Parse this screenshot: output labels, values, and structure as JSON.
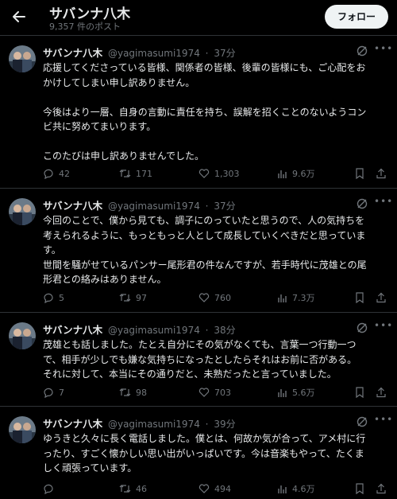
{
  "header": {
    "title": "サバンナ八木",
    "post_count": "9,357 件のポスト",
    "follow_label": "フォロー"
  },
  "colors": {
    "background": "#000000",
    "text": "#e7e9ea",
    "muted": "#71767b",
    "divider": "#2f3336",
    "follow_bg": "#eff3f4"
  },
  "icons": [
    "back-arrow-icon",
    "grok-icon",
    "more-icon",
    "reply-icon",
    "repost-icon",
    "like-icon",
    "views-icon",
    "bookmark-icon",
    "share-icon"
  ],
  "tweets": [
    {
      "name": "サバンナ八木",
      "handle": "@yagimasumi1974",
      "dot": "·",
      "time": "37分",
      "lines": [
        "応援してくださっている皆様、関係者の皆様、後輩の皆様にも、ご心配をお",
        "かけしてしまい申し訳ありません。",
        "",
        "今後はより一層、自身の言動に責任を持ち、誤解を招くことのないようコン",
        "ビ共に努めてまいります。",
        "",
        "このたびは申し訳ありませんでした。"
      ],
      "replies": "42",
      "reposts": "171",
      "likes": "1,303",
      "views": "9.6万"
    },
    {
      "name": "サバンナ八木",
      "handle": "@yagimasumi1974",
      "dot": "·",
      "time": "37分",
      "lines": [
        "今回のことで、僕から見ても、調子にのっていたと思うので、人の気持ちを",
        "考えられるように、もっともっと人として成長していくべきだと思っていま",
        "す。",
        "世間を騒がせているパンサー尾形君の件なんですが、若手時代に茂雄との尾",
        "形君との絡みはありません。"
      ],
      "replies": "5",
      "reposts": "97",
      "likes": "760",
      "views": "7.3万"
    },
    {
      "name": "サバンナ八木",
      "handle": "@yagimasumi1974",
      "dot": "·",
      "time": "38分",
      "lines": [
        "茂雄とも話しました。たとえ自分にその気がなくても、言葉一つ行動一つ",
        "で、相手が少しでも嫌な気持ちになったとしたらそれはお前に否がある。",
        "それに対して、本当にその通りだと、未熟だったと言っていました。"
      ],
      "replies": "7",
      "reposts": "98",
      "likes": "703",
      "views": "5.6万"
    },
    {
      "name": "サバンナ八木",
      "handle": "@yagimasumi1974",
      "dot": "·",
      "time": "39分",
      "lines": [
        "ゆうきと久々に長く電話しました。僕とは、何故か気が合って、アメ村に行",
        "ったり、すごく懐かしい思い出がいっぱいです。今は音楽もやって、たくま",
        "しく頑張っています。"
      ],
      "replies": "",
      "reposts": "46",
      "likes": "494",
      "views": "4.6万"
    }
  ]
}
